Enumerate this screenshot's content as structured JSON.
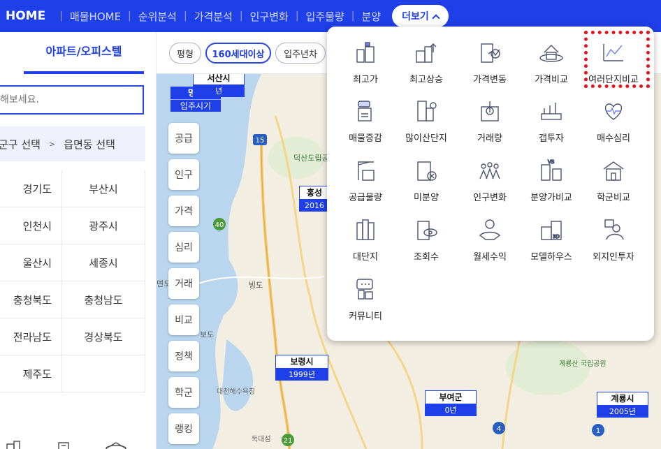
{
  "nav": {
    "home": "HOME",
    "items": [
      "매물HOME",
      "순위분석",
      "가격분석",
      "인구변화",
      "입주물량",
      "분양"
    ],
    "more": "더보기"
  },
  "left": {
    "tab": "아파트/오피스텔",
    "search_placeholder": "해보세요.",
    "region_gu": "군구 선택",
    "region_arrow": ">",
    "region_dong": "읍면동 선택",
    "regions": [
      "경기도",
      "부산시",
      "인천시",
      "광주시",
      "울산시",
      "세종시",
      "충청북도",
      "충청남도",
      "전라남도",
      "경상북도",
      "제주도"
    ]
  },
  "filters": [
    "평형",
    "160세대이상",
    "입주년차"
  ],
  "map": {
    "side_menu": [
      "공급",
      "인구",
      "가격",
      "심리",
      "거래",
      "비교",
      "정책",
      "학군",
      "랭킹"
    ],
    "legend_top": "명칭",
    "legend_bottom": "입주시기",
    "markers": [
      {
        "name": "서산시",
        "year": "년"
      },
      {
        "name": "홍성",
        "year": "2016"
      },
      {
        "name": "보령시",
        "year": "1999년"
      },
      {
        "name": "부여군",
        "year": "0년"
      },
      {
        "name": "계룡시",
        "year": "2005년"
      }
    ],
    "labels": [
      "덕산도립공원",
      "대천해수욕장",
      "독대섬",
      "계룡산 국립공원",
      "빙도",
      "보도",
      "면도"
    ],
    "roads": [
      "15",
      "40",
      "21",
      "4",
      "1"
    ]
  },
  "dropdown": {
    "items": [
      "최고가",
      "최고상승",
      "가격변동",
      "가격비교",
      "여러단지비교",
      "매물증감",
      "많이산단지",
      "거래량",
      "갭투자",
      "매수심리",
      "공급물량",
      "미분양",
      "인구변화",
      "분양가비교",
      "학군비교",
      "대단지",
      "조회수",
      "월세수익",
      "모델하우스",
      "외지인투자",
      "커뮤니티"
    ],
    "icon_names": [
      "building-thumbs-up-icon",
      "building-arrow-up-icon",
      "building-chart-icon",
      "house-compare-icon",
      "line-chart-icon",
      "listing-change-icon",
      "buildings-sold-icon",
      "trade-volume-icon",
      "gap-invest-icon",
      "heart-pulse-icon",
      "crane-supply-icon",
      "unsold-building-icon",
      "population-icon",
      "presale-compare-icon",
      "school-icon",
      "big-complex-icon",
      "view-count-icon",
      "rent-income-icon",
      "model-house-icon",
      "outside-investor-icon",
      "community-icon"
    ]
  },
  "colors": {
    "brand": "#1f3fe8",
    "highlight": "#e8101a"
  }
}
